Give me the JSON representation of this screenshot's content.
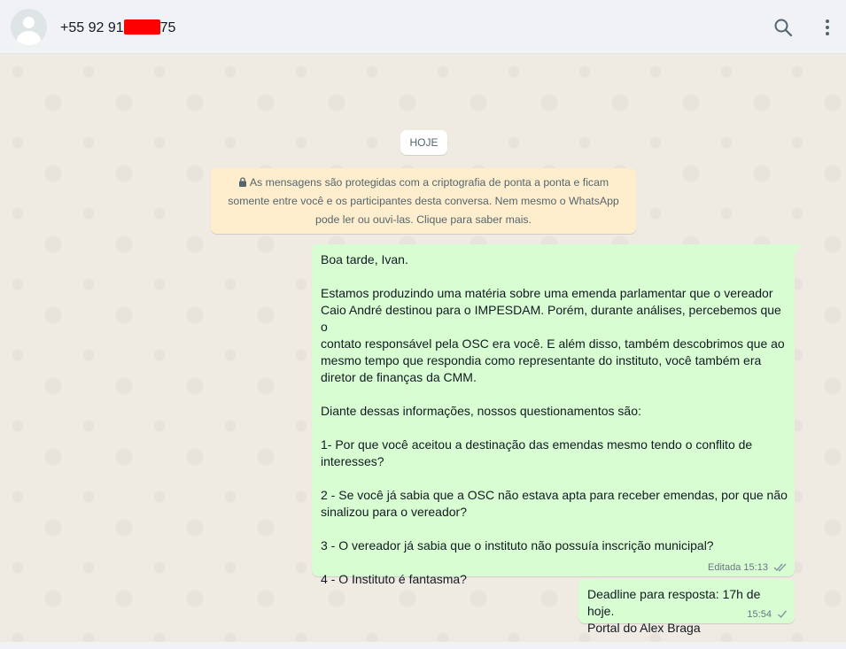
{
  "header": {
    "contact_prefix": "+55 92 91",
    "contact_suffix": "75",
    "search_icon": "search-icon",
    "menu_icon": "kebab-menu-icon"
  },
  "chat": {
    "date_label": "HOJE",
    "encryption_notice": "As mensagens são protegidas com a criptografia de ponta a ponta e ficam somente entre você e os participantes desta conversa. Nem mesmo o WhatsApp pode ler ou ouvi-las. Clique para saber mais.",
    "messages": [
      {
        "lines": [
          "Boa tarde, Ivan.",
          "",
          "Estamos produzindo uma matéria sobre uma emenda parlamentar que o vereador",
          "Caio André destinou para o IMPESDAM. Porém, durante análises, percebemos que o",
          "contato responsável pela OSC era você. E além disso, também descobrimos que ao",
          "mesmo tempo que respondia como representante do instituto, você também era",
          "diretor de finanças da CMM.",
          "",
          "Diante dessas informações, nossos questionamentos são:",
          "",
          "1- Por que você aceitou a destinação das emendas mesmo tendo o conflito de",
          "interesses?",
          "",
          "2 - Se você já sabia que a OSC não estava apta para receber emendas, por que não",
          "sinalizou para o vereador?",
          "",
          "3 - O vereador já sabia que o instituto não possuía inscrição municipal?",
          "",
          "4 - O Instituto é fantasma?"
        ],
        "status": "Editada",
        "time": "15:13",
        "tick": "double-check"
      },
      {
        "lines": [
          "Deadline para resposta: 17h de hoje.",
          "Portal do Alex Braga"
        ],
        "time": "15:54",
        "tick": "single-check"
      }
    ]
  },
  "colors": {
    "outgoing_bubble": "#d9fdd3",
    "chat_background": "#efeae2",
    "notice_background": "#ffeecd",
    "header_background": "#f0f2f5",
    "redaction": "#ff0000"
  }
}
